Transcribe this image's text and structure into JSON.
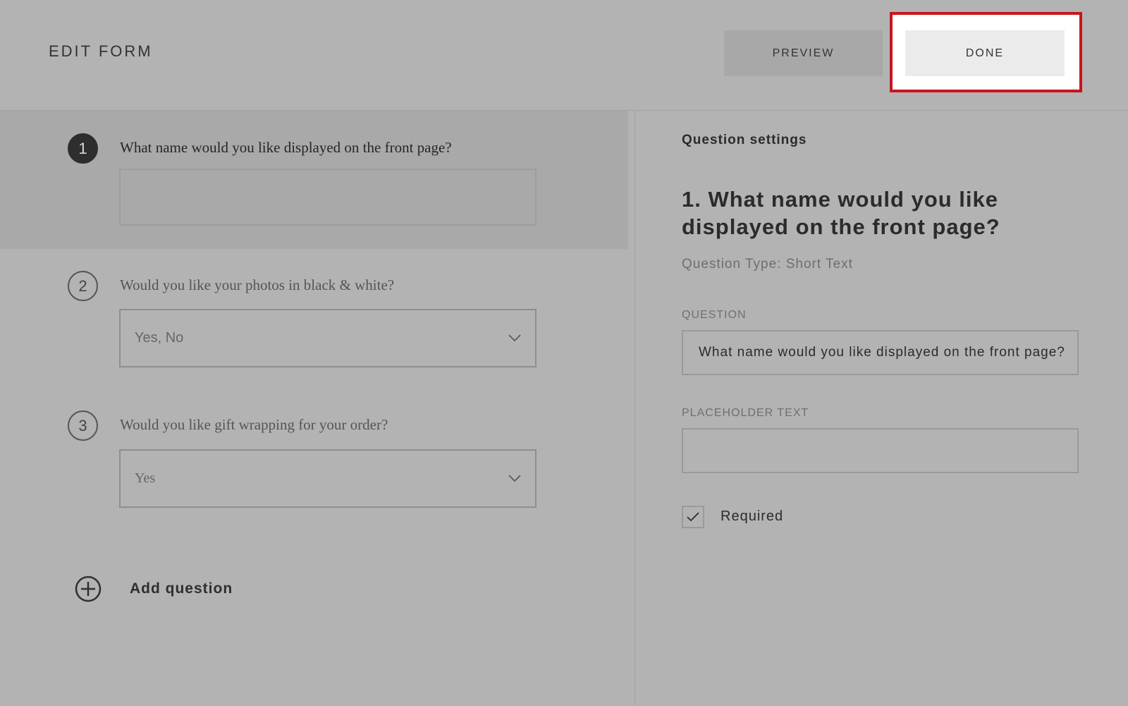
{
  "header": {
    "title": "EDIT FORM",
    "preview_label": "PREVIEW",
    "done_label": "DONE"
  },
  "questions": [
    {
      "number": "1",
      "text": "What name would you like displayed on the front page?",
      "value": ""
    },
    {
      "number": "2",
      "text": "Would you like your photos in black & white?",
      "value": "Yes, No"
    },
    {
      "number": "3",
      "text": "Would you like gift wrapping for your order?",
      "value": "Yes"
    }
  ],
  "add_question_label": "Add question",
  "settings": {
    "title": "Question settings",
    "heading": "1. What name would you like displayed on the front page?",
    "type": "Question Type: Short Text",
    "question_label": "QUESTION",
    "question_value": "What name would you like displayed on the front page?",
    "placeholder_label": "PLACEHOLDER TEXT",
    "placeholder_value": "",
    "required_label": "Required",
    "required_checked": true
  },
  "colors": {
    "highlight": "#c8141e",
    "background": "#b3b3b3"
  }
}
